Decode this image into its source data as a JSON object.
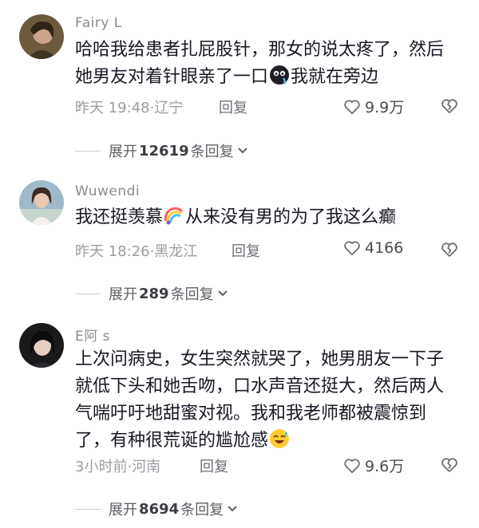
{
  "comments": [
    {
      "username": "Fairy  L",
      "text_parts": [
        "哈哈我给患者扎屁股针，那女的说太疼了，然后她男友对着针眼亲了一口",
        "我就在旁边"
      ],
      "emoji_names": [
        "black-blob-face-emoji"
      ],
      "time": "昨天 19:48",
      "location": "辽宁",
      "reply_label": "回复",
      "likes": "9.9万",
      "expand_prefix": "展开",
      "expand_count": "12619",
      "expand_suffix": "条回复"
    },
    {
      "username": "Wuwendi",
      "text_parts": [
        "我还挺羡慕",
        "从来没有男的为了我这么癫"
      ],
      "emoji_names": [
        "rainbow-fan-emoji"
      ],
      "time": "昨天 18:26",
      "location": "黑龙江",
      "reply_label": "回复",
      "likes": "4166",
      "expand_prefix": "展开",
      "expand_count": "289",
      "expand_suffix": "条回复"
    },
    {
      "username": "E阿 s",
      "text_parts": [
        "上次问病史，女生突然就哭了，她男朋友一下子就低下头和她舌吻，口水声音还挺大，然后两人气喘吁吁地甜蜜对视。我和我老师都被震惊到了，有种很荒诞的尴尬感",
        ""
      ],
      "emoji_names": [
        "grinning-sweat-emoji"
      ],
      "time": "3小时前",
      "location": "河南",
      "reply_label": "回复",
      "likes": "9.6万",
      "expand_prefix": "展开",
      "expand_count": "8694",
      "expand_suffix": "条回复"
    }
  ],
  "icons": {
    "like": "heart-outline-icon",
    "dislike": "broken-heart-icon",
    "expand": "chevron-down-icon"
  },
  "colors": {
    "text": "#161823",
    "muted": "#8a8b91",
    "background": "#ffffff"
  }
}
